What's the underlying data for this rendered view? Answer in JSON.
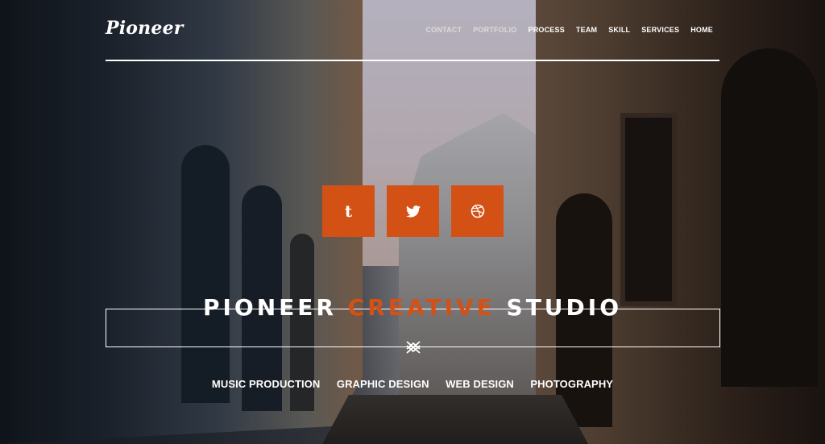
{
  "brand": {
    "logo_text": "Pioneer"
  },
  "nav": {
    "items": [
      {
        "label": "CONTACT"
      },
      {
        "label": "PORTFOLIO"
      },
      {
        "label": "PROCESS"
      },
      {
        "label": "TEAM"
      },
      {
        "label": "SKILL"
      },
      {
        "label": "SERVICES"
      },
      {
        "label": "HOME"
      }
    ]
  },
  "social": {
    "icons": [
      "tumblr-icon",
      "twitter-icon",
      "dribbble-icon"
    ],
    "tumblr_glyph": "t"
  },
  "hero": {
    "title_part1": "PIONEER ",
    "title_accent": "CREATIVE",
    "title_part2": " STUDIO"
  },
  "services": [
    {
      "label": "MUSIC PRODUCTION"
    },
    {
      "label": "GRAPHIC DESIGN"
    },
    {
      "label": "WEB DESIGN"
    },
    {
      "label": "PHOTOGRAPHY"
    }
  ],
  "colors": {
    "accent": "#d45116",
    "text": "#ffffff"
  }
}
